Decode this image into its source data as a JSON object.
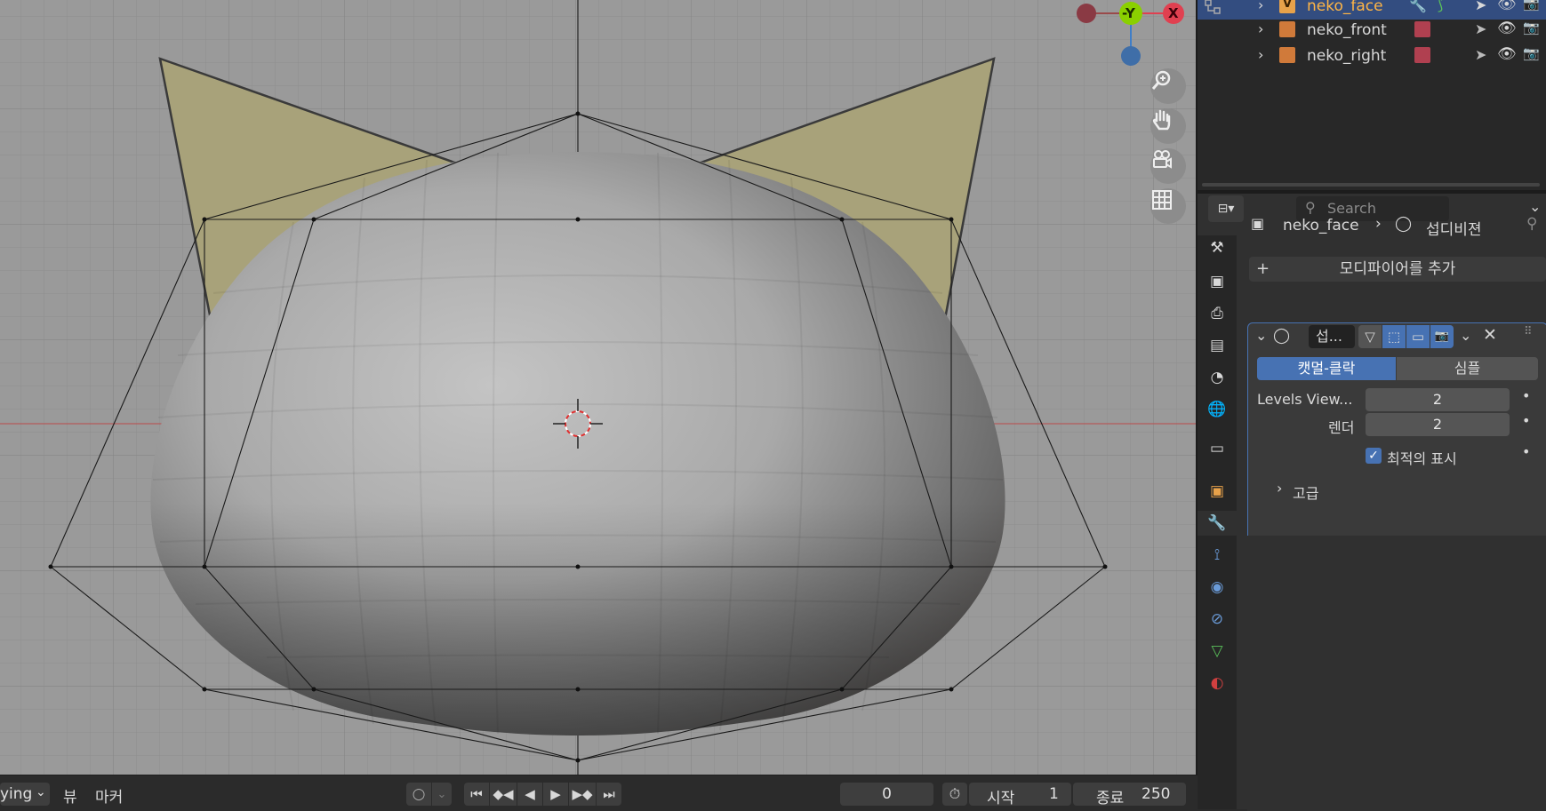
{
  "viewport": {
    "gizmo": {
      "neg_x": "",
      "y_label": "-Y",
      "x_label": "X",
      "z_label": ""
    }
  },
  "outliner": {
    "rows": [
      {
        "name": "neko_face"
      },
      {
        "name": "neko_front"
      },
      {
        "name": "neko_right"
      }
    ]
  },
  "properties": {
    "search_placeholder": "Search",
    "breadcrumb": {
      "object": "neko_face",
      "modifier": "섭디비젼"
    },
    "add_modifier_label": "모디파이어를 추가",
    "modifier": {
      "name": "섭...",
      "mode_catmull": "캣멀-클락",
      "mode_simple": "심플",
      "levels_viewport_label": "Levels View...",
      "levels_viewport_value": "2",
      "render_label": "렌더",
      "render_value": "2",
      "optimal_display_label": "최적의 표시",
      "optimal_display_checked": true,
      "advanced_label": "고급"
    }
  },
  "timeline": {
    "playing_label": "ying",
    "menu_view": "뷰",
    "menu_marker": "마커",
    "current_frame": "0",
    "start_label": "시작",
    "start_value": "1",
    "end_label": "종료",
    "end_value": "250"
  },
  "colors": {
    "accent": "#4772b3",
    "x_axis": "#e04050",
    "y_axis": "#8ad000",
    "z_axis": "#3f7ec8",
    "ear": "#a8a27a"
  }
}
